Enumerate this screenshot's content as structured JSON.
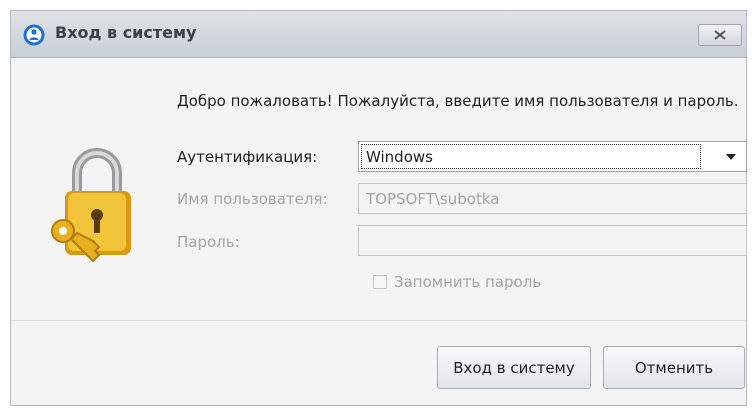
{
  "window": {
    "title": "Вход в систему"
  },
  "welcome_text": "Добро пожаловать! Пожалуйста, введите имя пользователя и пароль.",
  "form": {
    "auth_label": "Аутентификация:",
    "auth_value": "Windows",
    "username_label": "Имя пользователя:",
    "username_value": "TOPSOFT\\subotka",
    "password_label": "Пароль:",
    "password_value": "",
    "remember_label": "Запомнить пароль",
    "remember_checked": false
  },
  "buttons": {
    "login": "Вход в систему",
    "cancel": "Отменить"
  },
  "icons": {
    "app": "user-login-icon",
    "lock": "padlock-with-key-icon",
    "close": "close-icon",
    "dropdown": "dropdown-arrow-icon"
  },
  "colors": {
    "accent": "#1f6fd6",
    "lock_gold": "#e8b020",
    "disabled_text": "#a5a5a5"
  }
}
